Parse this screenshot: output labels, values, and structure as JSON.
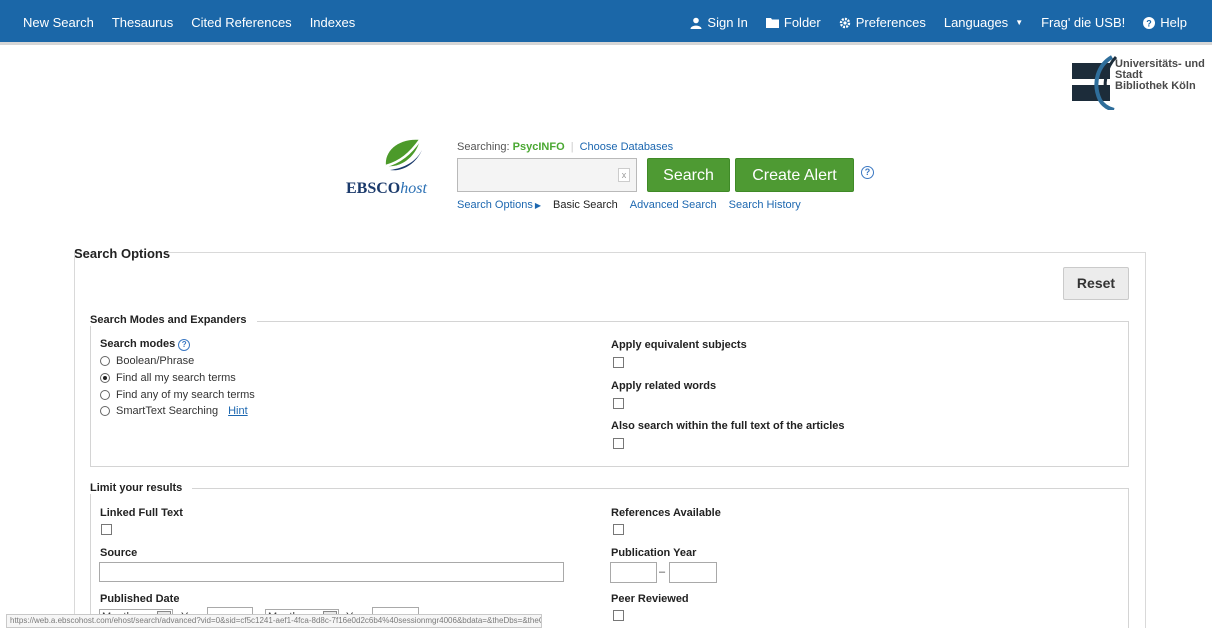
{
  "nav": {
    "left": [
      "New Search",
      "Thesaurus",
      "Cited References",
      "Indexes"
    ],
    "sign_in": "Sign In",
    "folder": "Folder",
    "preferences": "Preferences",
    "languages": "Languages",
    "frag": "Frag' die USB!",
    "help": "Help"
  },
  "library": {
    "name_line1": "Universitäts- und",
    "name_line2": "Stadt",
    "name_line3": "Bibliothek Köln"
  },
  "brand": {
    "ebsco": "EBSCO",
    "host": "host"
  },
  "searching": {
    "label": "Searching:",
    "database": "PsycINFO",
    "choose": "Choose Databases"
  },
  "search": {
    "value": "",
    "clear": "x",
    "search_button": "Search",
    "alert_button": "Create Alert",
    "help": "?"
  },
  "sublinks": {
    "options": "Search Options",
    "basic": "Basic Search",
    "advanced": "Advanced Search",
    "history": "Search History"
  },
  "options": {
    "title": "Search Options",
    "reset": "Reset",
    "modes_group": "Search Modes and Expanders",
    "modes_label": "Search modes",
    "modes": [
      "Boolean/Phrase",
      "Find all my search terms",
      "Find any of my search terms",
      "SmartText Searching"
    ],
    "selected_mode": "Find all my search terms",
    "hint": "Hint",
    "expanders": [
      "Apply equivalent subjects",
      "Apply related words",
      "Also search within the full text of the articles"
    ],
    "limit_group": "Limit your results",
    "linked_full_text": "Linked Full Text",
    "references_available": "References Available",
    "source": "Source",
    "publication_year": "Publication Year",
    "year_dash": "–",
    "published_date": "Published Date",
    "month": "Month",
    "year": "Year:",
    "peer_reviewed": "Peer Reviewed"
  },
  "status": {
    "url": "https://web.a.ebscohost.com/ehost/search/advanced?vid=0&sid=cf5c1241-aef1-4fca-8d8c-7f16e0d2c6b4%40sessionmgr4006&bdata=&theDbs=&theContentTypes="
  }
}
